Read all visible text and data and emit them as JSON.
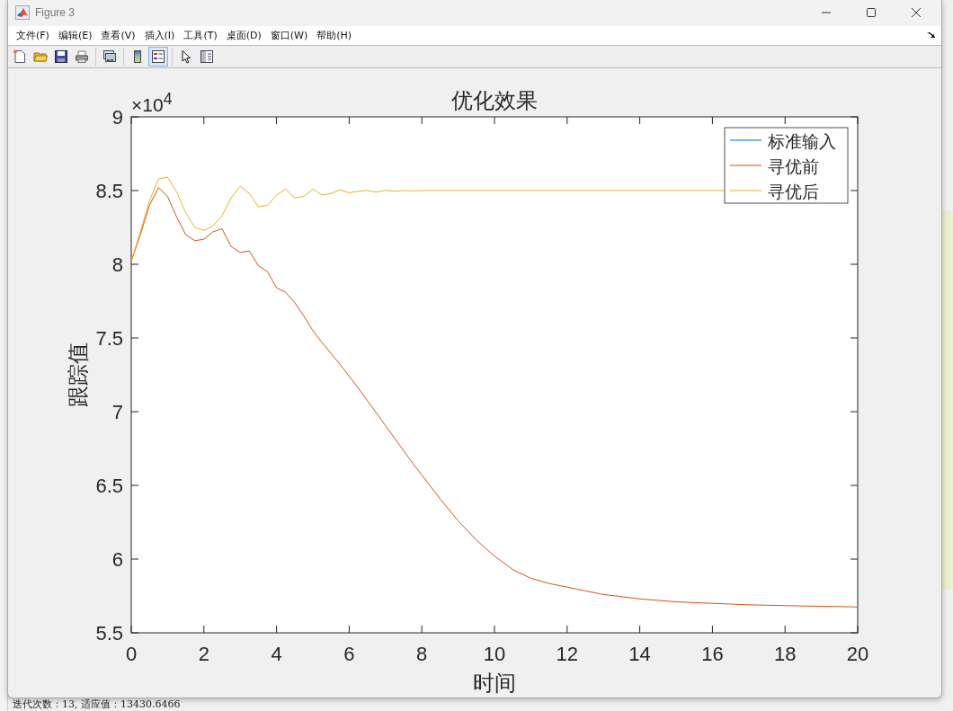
{
  "window": {
    "title": "Figure 3"
  },
  "menu": [
    "文件(F)",
    "编辑(E)",
    "查看(V)",
    "插入(I)",
    "工具(T)",
    "桌面(D)",
    "窗口(W)",
    "帮助(H)"
  ],
  "toolbar": [
    {
      "buttons": [
        {
          "kind": "new",
          "on": false
        },
        {
          "kind": "open",
          "on": false
        },
        {
          "kind": "save",
          "on": false
        },
        {
          "kind": "print",
          "on": false
        }
      ]
    },
    {
      "buttons": [
        {
          "kind": "link",
          "on": false
        }
      ]
    },
    {
      "buttons": [
        {
          "kind": "colorbar",
          "on": false
        },
        {
          "kind": "legend",
          "on": true
        }
      ]
    },
    {
      "buttons": [
        {
          "kind": "pointer",
          "on": false
        },
        {
          "kind": "browser",
          "on": false
        }
      ]
    }
  ],
  "figure": {
    "exponent_label": "×10$^{4}$",
    "chart_data": {
      "type": "line",
      "title": "优化效果",
      "xlabel": "时间",
      "ylabel": "跟踪值",
      "x": [
        0,
        0.25,
        0.5,
        0.75,
        1,
        1.25,
        1.5,
        1.75,
        2,
        2.25,
        2.5,
        2.75,
        3,
        3.25,
        3.5,
        3.75,
        4,
        4.25,
        4.5,
        4.75,
        5,
        5.25,
        5.5,
        5.75,
        6,
        6.25,
        6.5,
        6.75,
        7,
        7.25,
        7.5,
        7.75,
        8,
        8.5,
        9,
        9.5,
        10,
        10.5,
        11,
        11.5,
        12,
        12.5,
        13,
        13.5,
        14,
        14.5,
        15,
        15.5,
        16,
        16.5,
        17,
        17.5,
        18,
        18.5,
        19,
        19.5,
        19.8,
        20
      ],
      "series": [
        {
          "name": "标准输入",
          "color": "#0072bd",
          "values": [
            null,
            null,
            null,
            null,
            null,
            null,
            null,
            null,
            null,
            null,
            null,
            null,
            null,
            null,
            null,
            null,
            null,
            null,
            null,
            null,
            null,
            null,
            null,
            null,
            null,
            null,
            null,
            null,
            null,
            null,
            null,
            null,
            null,
            null,
            null,
            null,
            null,
            null,
            null,
            null,
            null,
            null,
            null,
            null,
            null,
            null,
            null,
            null,
            null,
            null,
            null,
            null,
            null,
            null,
            null,
            null,
            null,
            null
          ]
        },
        {
          "name": "寻优前",
          "color": "#d95319",
          "values": [
            8.02,
            8.2,
            8.4,
            8.52,
            8.46,
            8.32,
            8.2,
            8.16,
            8.17,
            8.22,
            8.24,
            8.12,
            8.08,
            8.09,
            7.99,
            7.95,
            7.84,
            7.81,
            7.74,
            7.65,
            7.55,
            7.47,
            7.395,
            7.32,
            7.24,
            7.16,
            7.075,
            6.99,
            6.905,
            6.82,
            6.735,
            6.65,
            6.57,
            6.41,
            6.26,
            6.13,
            6.02,
            5.93,
            5.87,
            5.835,
            5.81,
            5.785,
            5.76,
            5.745,
            5.73,
            5.72,
            5.71,
            5.705,
            5.7,
            5.695,
            5.69,
            5.687,
            5.685,
            5.682,
            5.68,
            5.678,
            5.676,
            5.675
          ]
        },
        {
          "name": "寻优后",
          "color": "#edb120",
          "values": [
            8.02,
            8.22,
            8.43,
            8.58,
            8.59,
            8.49,
            8.35,
            8.25,
            8.23,
            8.26,
            8.33,
            8.45,
            8.53,
            8.48,
            8.39,
            8.4,
            8.47,
            8.51,
            8.45,
            8.46,
            8.51,
            8.47,
            8.48,
            8.505,
            8.485,
            8.495,
            8.5,
            8.49,
            8.502,
            8.495,
            8.5,
            8.498,
            8.5,
            8.5,
            8.5,
            8.5,
            8.5,
            8.5,
            8.5,
            8.5,
            8.5,
            8.5,
            8.5,
            8.5,
            8.5,
            8.5,
            8.5,
            8.5,
            8.5,
            8.5,
            8.5,
            null,
            null,
            null,
            null,
            null,
            null,
            null
          ]
        }
      ],
      "legend": "upper right",
      "xlim": [
        0,
        20
      ],
      "ylim": [
        5.5,
        9
      ],
      "xticks": [
        0,
        2,
        4,
        6,
        8,
        10,
        12,
        14,
        16,
        18,
        20
      ],
      "yticks": [
        5.5,
        6,
        6.5,
        7,
        7.5,
        8,
        8.5,
        9
      ]
    }
  },
  "console_line": "迭代次数：13, 适应值：13430.6466"
}
